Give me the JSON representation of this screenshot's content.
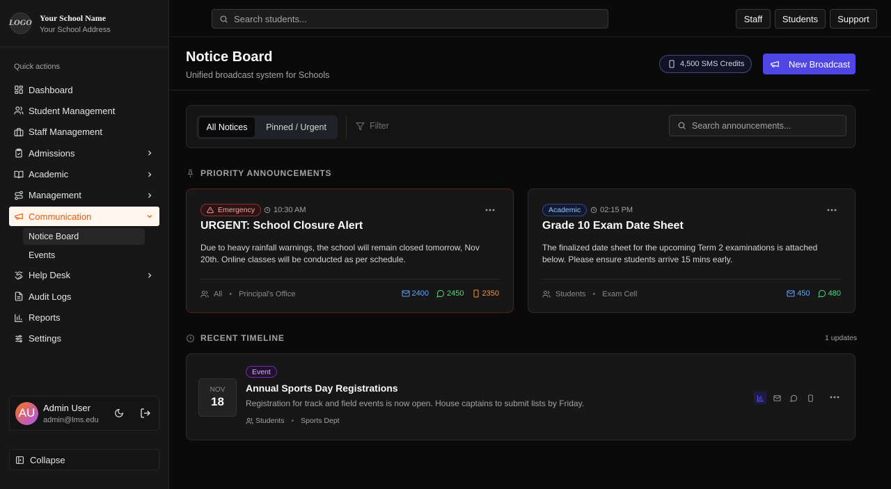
{
  "school": {
    "name": "Your School Name",
    "address": "Your School Address",
    "logo_text": "LOGO"
  },
  "sidebar": {
    "section_label": "Quick actions",
    "items": [
      {
        "label": "Dashboard"
      },
      {
        "label": "Student Management"
      },
      {
        "label": "Staff Management"
      },
      {
        "label": "Admissions"
      },
      {
        "label": "Academic"
      },
      {
        "label": "Management"
      },
      {
        "label": "Communication"
      },
      {
        "label": "Help Desk"
      },
      {
        "label": "Audit Logs"
      },
      {
        "label": "Reports"
      },
      {
        "label": "Settings"
      }
    ],
    "communication_sub": [
      {
        "label": "Notice Board"
      },
      {
        "label": "Events"
      }
    ],
    "user": {
      "initials": "AU",
      "name": "Admin User",
      "email": "admin@lms.edu"
    },
    "collapse_label": "Collapse"
  },
  "topbar": {
    "search_placeholder": "Search students...",
    "buttons": [
      "Staff",
      "Students",
      "Support"
    ]
  },
  "header": {
    "title": "Notice Board",
    "subtitle": "Unified broadcast system for Schools",
    "sms_credits": "4,500 SMS Credits",
    "broadcast_label": "New Broadcast"
  },
  "filters": {
    "tabs": [
      "All Notices",
      "Pinned / Urgent"
    ],
    "filter_label": "Filter",
    "search_placeholder": "Search announcements..."
  },
  "priority": {
    "label": "PRIORITY ANNOUNCEMENTS",
    "cards": [
      {
        "tag": "Emergency",
        "time": "10:30 AM",
        "title": "URGENT: School Closure Alert",
        "body": "Due to heavy rainfall warnings, the school will remain closed tomorrow, Nov 20th. Online classes will be conducted as per schedule.",
        "audience": "All",
        "source": "Principal's Office",
        "email": "2400",
        "whatsapp": "2450",
        "sms": "2350"
      },
      {
        "tag": "Academic",
        "time": "02:15 PM",
        "title": "Grade 10 Exam Date Sheet",
        "body": "The finalized date sheet for the upcoming Term 2 examinations is attached below. Please ensure students arrive 15 mins early.",
        "audience": "Students",
        "source": "Exam Cell",
        "email": "450",
        "whatsapp": "480"
      }
    ]
  },
  "timeline": {
    "label": "RECENT TIMELINE",
    "count": "1 updates",
    "items": [
      {
        "month": "NOV",
        "day": "18",
        "tag": "Event",
        "title": "Annual Sports Day Registrations",
        "desc": "Registration for track and field events is now open. House captains to submit lists by Friday.",
        "audience": "Students",
        "source": "Sports Dept"
      }
    ]
  },
  "colors": {
    "accent": "#4f46e5",
    "active_nav": "#ea580c",
    "emergency": "#fca5a5",
    "email": "#60a5fa",
    "whatsapp": "#4ade80",
    "sms": "#fb923c"
  }
}
